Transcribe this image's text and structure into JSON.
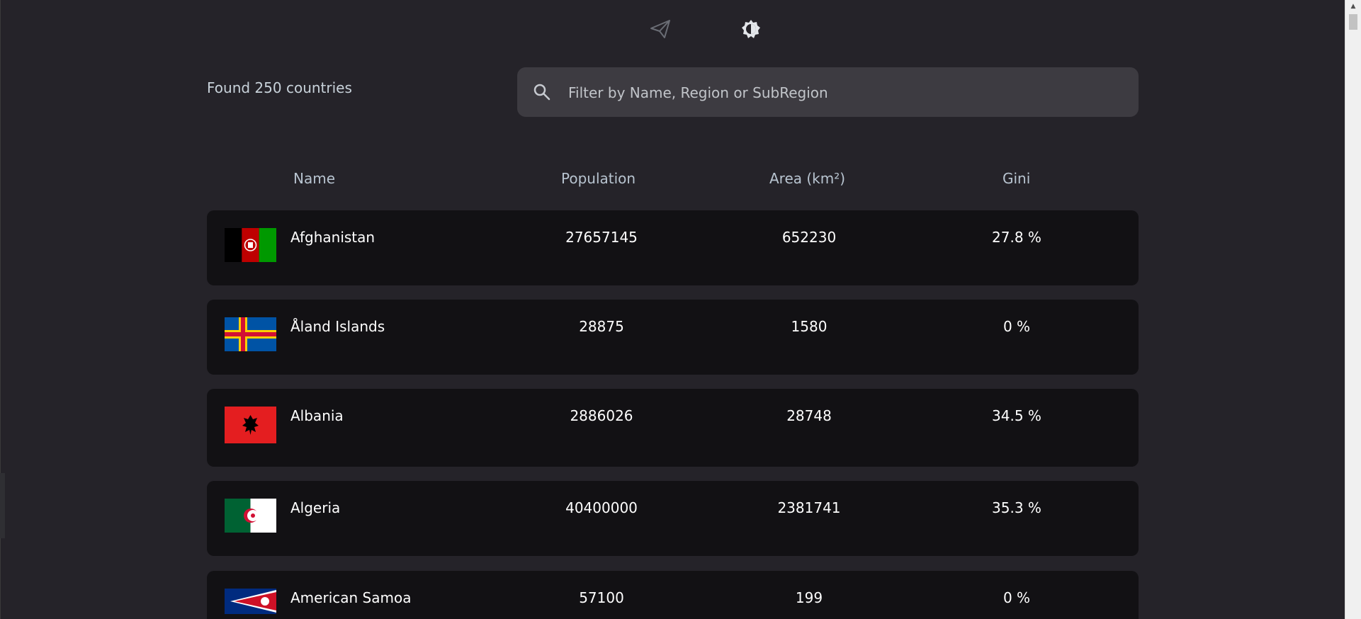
{
  "header_icons": [
    "send-icon",
    "theme-contrast-icon"
  ],
  "summary": {
    "found_text": "Found 250 countries"
  },
  "search": {
    "placeholder": "Filter by Name, Region or SubRegion",
    "value": ""
  },
  "table": {
    "columns": {
      "name": "Name",
      "population": "Population",
      "area": "Area (km²)",
      "gini": "Gini"
    },
    "rows": [
      {
        "name": "Afghanistan",
        "population": "27657145",
        "area": "652230",
        "gini": "27.8 %",
        "flag": "afghanistan-flag"
      },
      {
        "name": "Åland Islands",
        "population": "28875",
        "area": "1580",
        "gini": "0 %",
        "flag": "aland-islands-flag"
      },
      {
        "name": "Albania",
        "population": "2886026",
        "area": "28748",
        "gini": "34.5 %",
        "flag": "albania-flag"
      },
      {
        "name": "Algeria",
        "population": "40400000",
        "area": "2381741",
        "gini": "35.3 %",
        "flag": "algeria-flag"
      },
      {
        "name": "American Samoa",
        "population": "57100",
        "area": "199",
        "gini": "0 %",
        "flag": "american-samoa-flag"
      }
    ]
  },
  "colors": {
    "background": "#252329",
    "row_background": "#121114",
    "search_background": "#3d3b41",
    "header_text": "#b8c4d0",
    "row_text": "#ffffff"
  }
}
